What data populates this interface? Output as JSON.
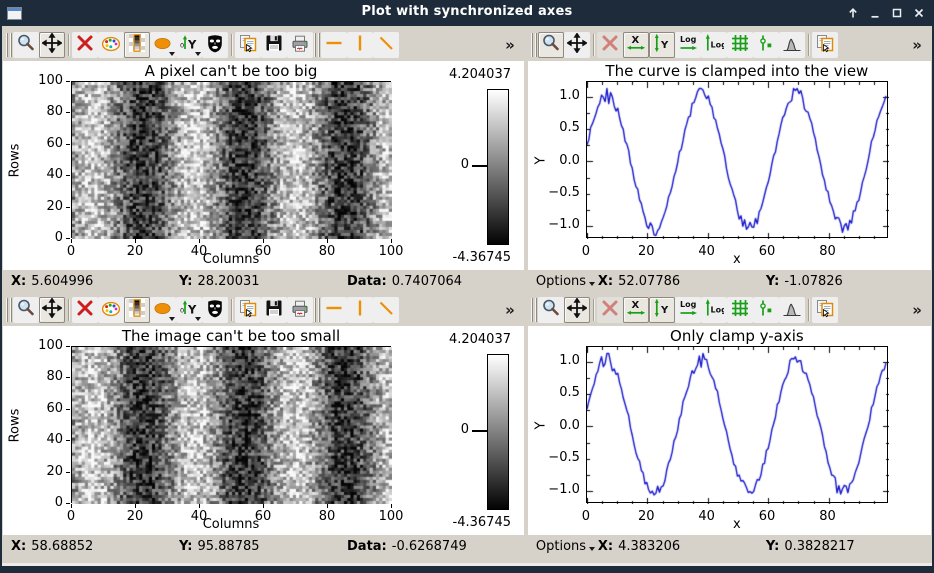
{
  "window": {
    "title": "Plot with synchronized axes",
    "controls": [
      {
        "name": "keep-above"
      },
      {
        "name": "minimize"
      },
      {
        "name": "maximize"
      },
      {
        "name": "close"
      }
    ]
  },
  "overflow_label": "»",
  "colors": {
    "titlebar": "#1d2b3b",
    "chrome": "#d6d2c9",
    "accent_orange": "#ee8f08",
    "toolbar_green": "#17a017",
    "curve_blue": "#1414cc",
    "plot_bg": "#ffffff"
  },
  "panels": [
    {
      "name": "image-panel-1",
      "kind": "image",
      "toolbar": [
        {
          "icon": "magnifier",
          "name": "rectangle-zoom"
        },
        {
          "icon": "pan",
          "name": "pan",
          "pressed": true
        },
        {
          "sep": true
        },
        {
          "icon": "delete",
          "name": "delete-item"
        },
        {
          "icon": "palette",
          "name": "colormap"
        },
        {
          "icon": "contrast",
          "name": "contrast-adjust",
          "pressed": true
        },
        {
          "icon": "ellipse",
          "name": "cross-section",
          "caret": true
        },
        {
          "icon": "yaxis",
          "name": "average-cross-section",
          "caret": true
        },
        {
          "icon": "mask",
          "name": "image-mask"
        },
        {
          "sep": true
        },
        {
          "icon": "copy",
          "name": "copy-to-clipboard"
        },
        {
          "icon": "save",
          "name": "save"
        },
        {
          "icon": "print",
          "name": "print"
        },
        {
          "handle": true
        },
        {
          "icon": "hline",
          "name": "horizontal-cursor"
        },
        {
          "icon": "vline",
          "name": "vertical-cursor"
        },
        {
          "icon": "oblique",
          "name": "oblique-cursor"
        }
      ],
      "plot": {
        "title": "A pixel can't be too big",
        "xlabel": "Columns",
        "ylabel": "Rows",
        "xticks": [
          "0",
          "20",
          "40",
          "60",
          "80",
          "100"
        ],
        "xtick_vals": [
          0,
          20,
          40,
          60,
          80,
          100
        ],
        "yticks": [
          "0",
          "20",
          "40",
          "60",
          "80",
          "100"
        ],
        "ytick_vals": [
          0,
          20,
          40,
          60,
          80,
          100
        ],
        "colorbar": {
          "top": "4.204037",
          "zero": "0",
          "bottom": "-4.36745"
        }
      },
      "status": {
        "items": [
          {
            "label": "X:",
            "value": "5.604996"
          },
          {
            "label": "Y:",
            "value": "28.20031"
          },
          {
            "label": "Data:",
            "value": "0.7407064"
          }
        ]
      }
    },
    {
      "name": "curve-panel-1",
      "kind": "curve",
      "toolbar": [
        {
          "icon": "magnifier",
          "name": "rectangle-zoom",
          "pressed": true
        },
        {
          "icon": "pan",
          "name": "pan"
        },
        {
          "sep": true
        },
        {
          "icon": "delete",
          "name": "delete-item",
          "disabled": true
        },
        {
          "icon": "xrange",
          "name": "x-axis-autoscale",
          "pressed": true
        },
        {
          "icon": "yrange",
          "name": "y-axis-autoscale",
          "pressed": true
        },
        {
          "icon": "logx",
          "name": "x-log-scale"
        },
        {
          "icon": "logy",
          "name": "y-log-scale"
        },
        {
          "icon": "grid",
          "name": "grid"
        },
        {
          "icon": "levels",
          "name": "curve-markers"
        },
        {
          "icon": "gauss",
          "name": "curve-antialiasing"
        },
        {
          "sep": true
        },
        {
          "icon": "copy",
          "name": "copy-to-clipboard"
        }
      ],
      "plot": {
        "title": "The curve is clamped into the view",
        "xlabel": "x",
        "ylabel": "Y",
        "xticks": [
          "0",
          "20",
          "40",
          "60",
          "80"
        ],
        "xtick_vals": [
          0,
          20,
          40,
          60,
          80
        ],
        "yticks": [
          "1.0",
          "0.5",
          "0.0",
          "−0.5",
          "−1.0"
        ],
        "ytick_vals": [
          1.0,
          0.5,
          0.0,
          -0.5,
          -1.0
        ],
        "signal": {
          "type": "noisy-sine",
          "period": 31.4,
          "amplitude": 1.0,
          "noise": 0.1
        }
      },
      "status": {
        "options": "Options",
        "items": [
          {
            "label": "X:",
            "value": "52.07786"
          },
          {
            "label": "Y:",
            "value": "-1.07826"
          }
        ]
      }
    },
    {
      "name": "image-panel-2",
      "kind": "image",
      "toolbar": [
        {
          "icon": "magnifier",
          "name": "rectangle-zoom"
        },
        {
          "icon": "pan",
          "name": "pan",
          "pressed": true
        },
        {
          "sep": true
        },
        {
          "icon": "delete",
          "name": "delete-item"
        },
        {
          "icon": "palette",
          "name": "colormap"
        },
        {
          "icon": "contrast",
          "name": "contrast-adjust",
          "pressed": true
        },
        {
          "icon": "ellipse",
          "name": "cross-section",
          "caret": true
        },
        {
          "icon": "yaxis",
          "name": "average-cross-section",
          "caret": true
        },
        {
          "icon": "mask",
          "name": "image-mask"
        },
        {
          "sep": true
        },
        {
          "icon": "copy",
          "name": "copy-to-clipboard"
        },
        {
          "icon": "save",
          "name": "save"
        },
        {
          "icon": "print",
          "name": "print"
        },
        {
          "handle": true
        },
        {
          "icon": "hline",
          "name": "horizontal-cursor"
        },
        {
          "icon": "vline",
          "name": "vertical-cursor"
        },
        {
          "icon": "oblique",
          "name": "oblique-cursor"
        }
      ],
      "plot": {
        "title": "The image can't be too small",
        "xlabel": "Columns",
        "ylabel": "Rows",
        "xticks": [
          "0",
          "20",
          "40",
          "60",
          "80",
          "100"
        ],
        "xtick_vals": [
          0,
          20,
          40,
          60,
          80,
          100
        ],
        "yticks": [
          "0",
          "20",
          "40",
          "60",
          "80",
          "100"
        ],
        "ytick_vals": [
          0,
          20,
          40,
          60,
          80,
          100
        ],
        "colorbar": {
          "top": "4.204037",
          "zero": "0",
          "bottom": "-4.36745"
        }
      },
      "status": {
        "items": [
          {
            "label": "X:",
            "value": "58.68852"
          },
          {
            "label": "Y:",
            "value": "95.88785"
          },
          {
            "label": "Data:",
            "value": "-0.6268749"
          }
        ]
      }
    },
    {
      "name": "curve-panel-2",
      "kind": "curve",
      "toolbar": [
        {
          "icon": "magnifier",
          "name": "rectangle-zoom"
        },
        {
          "icon": "pan",
          "name": "pan",
          "pressed": true
        },
        {
          "sep": true
        },
        {
          "icon": "delete",
          "name": "delete-item",
          "disabled": true
        },
        {
          "icon": "xrange",
          "name": "x-axis-autoscale",
          "pressed": true
        },
        {
          "icon": "yrange",
          "name": "y-axis-autoscale",
          "pressed": true
        },
        {
          "icon": "logx",
          "name": "x-log-scale"
        },
        {
          "icon": "logy",
          "name": "y-log-scale"
        },
        {
          "icon": "grid",
          "name": "grid"
        },
        {
          "icon": "levels",
          "name": "curve-markers"
        },
        {
          "icon": "gauss",
          "name": "curve-antialiasing"
        },
        {
          "sep": true
        },
        {
          "icon": "copy",
          "name": "copy-to-clipboard"
        }
      ],
      "plot": {
        "title": "Only clamp y-axis",
        "xlabel": "x",
        "ylabel": "Y",
        "xticks": [
          "0",
          "20",
          "40",
          "60",
          "80"
        ],
        "xtick_vals": [
          0,
          20,
          40,
          60,
          80
        ],
        "yticks": [
          "1.0",
          "0.5",
          "0.0",
          "−0.5",
          "−1.0"
        ],
        "ytick_vals": [
          1.0,
          0.5,
          0.0,
          -0.5,
          -1.0
        ],
        "signal": {
          "type": "noisy-sine",
          "period": 31.4,
          "amplitude": 1.0,
          "noise": 0.1
        }
      },
      "status": {
        "options": "Options",
        "items": [
          {
            "label": "X:",
            "value": "4.383206"
          },
          {
            "label": "Y:",
            "value": "0.3828217"
          }
        ]
      }
    }
  ]
}
